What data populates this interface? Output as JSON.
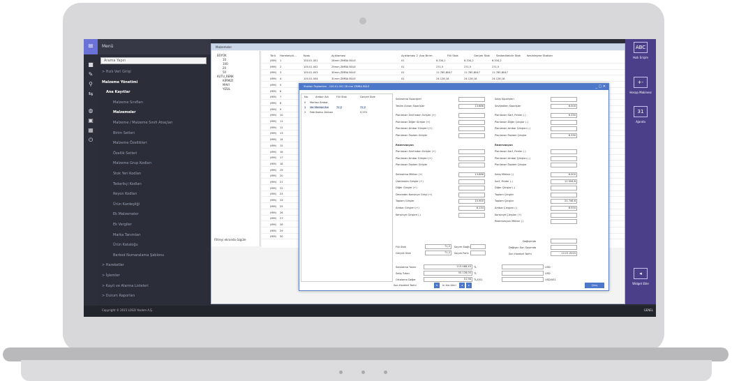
{
  "sidebar": {
    "title": "Menü",
    "search_placeholder": "Arama Yapın",
    "items": [
      {
        "label": "> Hızlı Veri Girişi",
        "bold": false
      },
      {
        "label": "Malzeme Yönetimi",
        "bold": true
      },
      {
        "label": "Ana Kayıtlar",
        "bold": true
      },
      {
        "label": "Malzeme Sınıfları",
        "bold": false
      },
      {
        "label": "Malzemeler",
        "bold": true
      },
      {
        "label": "Malzeme / Malzeme Sınıfı Atıaçları",
        "bold": false
      },
      {
        "label": "Birim Setleri",
        "bold": false
      },
      {
        "label": "Malzeme Özellikleri",
        "bold": false
      },
      {
        "label": "Özellik Setleri",
        "bold": false
      },
      {
        "label": "Malzeme Grup Kodları",
        "bold": false
      },
      {
        "label": "Stok Yeri Kodları",
        "bold": false
      },
      {
        "label": "Tedarikçi Kodları",
        "bold": false
      },
      {
        "label": "Reyon Kodları",
        "bold": false
      },
      {
        "label": "Ürün Kardeşliği",
        "bold": false
      },
      {
        "label": "Ek Malzemeler",
        "bold": false
      },
      {
        "label": "Ek Vergiler",
        "bold": false
      },
      {
        "label": "Marka Tanımları",
        "bold": false
      },
      {
        "label": "Ürün Kataloğu",
        "bold": false
      },
      {
        "label": "Barkod Numaralama Şablonu",
        "bold": false
      },
      {
        "label": "> Hareketler",
        "bold": false
      },
      {
        "label": "> İşlemler",
        "bold": false
      },
      {
        "label": "> Kayıt ve Alarma Listeleri",
        "bold": false
      },
      {
        "label": "> Durum Raporları",
        "bold": false
      }
    ]
  },
  "footer": {
    "copyright": "Copyright © 2015 LOGO Yazılım A.Ş.",
    "right": "GENEL"
  },
  "main_window": {
    "title": "Malzemeler",
    "tree": [
      "BÜYÜK",
      "10",
      "100",
      "20",
      "50",
      "KUTU_RENK",
      "KIRMIZI",
      "MAVI",
      "YESIL"
    ],
    "tree_footer": "Filtreyi ekranda özgüle",
    "columns": [
      "Türü",
      "Hareketçili...",
      "Kodu",
      "Açıklaması",
      "Açıklaması 2",
      "Ana Birim",
      "Fiili Stok",
      "Gerçek Stok",
      "Sevkedilebilir Stok",
      "Kesinleşme Stokları"
    ],
    "rows": [
      [
        "(MM)",
        "1",
        "100.01.001",
        "28mm ZIMBA BÜLE",
        "01",
        "6.334,1",
        "6.334,2",
        "6.334,2"
      ],
      [
        "(MM)",
        "2",
        "100.01.002",
        "29mm ZIMBA BÜLE",
        "01",
        "271,5",
        "271,5",
        "271,5"
      ],
      [
        "(MM)",
        "3",
        "100.01.003",
        "30mm ZIMBA BÜLE",
        "01",
        "11.780,8047",
        "11.780,8047",
        "11.780,8047"
      ],
      [
        "(MM)",
        "4",
        "100.01.004",
        "31mm ZIMBA BÜLE",
        "01",
        "24.128,18",
        "24.128,18",
        "24.128,18"
      ],
      [
        "(MM)",
        "5",
        "",
        "",
        "",
        "",
        "",
        ""
      ],
      [
        "(MM)",
        "6",
        "",
        "",
        "",
        "",
        "",
        ""
      ],
      [
        "(MM)",
        "7",
        "",
        "",
        "",
        "",
        "",
        ""
      ],
      [
        "(MM)",
        "8",
        "",
        "",
        "",
        "",
        "",
        ""
      ],
      [
        "(MM)",
        "9",
        "",
        "",
        "",
        "",
        "",
        ""
      ],
      [
        "(MM)",
        "10",
        "",
        "",
        "",
        "",
        "",
        ""
      ],
      [
        "(MM)",
        "11",
        "",
        "",
        "",
        "",
        "",
        ""
      ],
      [
        "(MM)",
        "12",
        "",
        "",
        "",
        "",
        "",
        ""
      ],
      [
        "(MM)",
        "13",
        "",
        "",
        "",
        "",
        "",
        ""
      ],
      [
        "(MM)",
        "14",
        "",
        "",
        "",
        "",
        "",
        ""
      ],
      [
        "(MM)",
        "15",
        "",
        "",
        "",
        "",
        "",
        ""
      ],
      [
        "(MM)",
        "16",
        "",
        "",
        "",
        "",
        "",
        ""
      ],
      [
        "(MM)",
        "17",
        "",
        "",
        "",
        "",
        "",
        ""
      ],
      [
        "(MM)",
        "18",
        "",
        "",
        "",
        "",
        "",
        ""
      ],
      [
        "(MM)",
        "19",
        "",
        "",
        "",
        "",
        "",
        ""
      ],
      [
        "(MM)",
        "20",
        "",
        "",
        "",
        "",
        "",
        ""
      ],
      [
        "(MM)",
        "21",
        "",
        "",
        "",
        "",
        "",
        ""
      ],
      [
        "(MM)",
        "22",
        "",
        "",
        "",
        "",
        "",
        ""
      ],
      [
        "(MM)",
        "23",
        "",
        "",
        "",
        "",
        "",
        ""
      ],
      [
        "(MM)",
        "24",
        "",
        "",
        "",
        "",
        "",
        ""
      ],
      [
        "(MM)",
        "25",
        "",
        "",
        "",
        "",
        "",
        ""
      ],
      [
        "(MM)",
        "26",
        "",
        "",
        "",
        "",
        "",
        ""
      ],
      [
        "(MM)",
        "27",
        "",
        "",
        "",
        "",
        "",
        ""
      ],
      [
        "(MM)",
        "28",
        "",
        "",
        "",
        "",
        "",
        ""
      ],
      [
        "(MM)",
        "29",
        "",
        "",
        "",
        "",
        "",
        ""
      ],
      [
        "(MM)",
        "30",
        "",
        "",
        "",
        "",
        "",
        ""
      ]
    ]
  },
  "dialog": {
    "title": "Stokları Toplamları - 100.01.001 28 mm ZIMBA BÜLE",
    "list_headers": [
      "No.",
      "Ambar Adı",
      "Fiili Stok",
      "Gerçek Stok"
    ],
    "list_rows": [
      [
        "0",
        "Merkez Ambar",
        "",
        ""
      ],
      [
        "1",
        "Ver Merkez Am",
        "71,2",
        "71,2"
      ],
      [
        "2",
        "Fabrikamız Ambarı",
        "",
        "0,251"
      ]
    ],
    "left_fields": [
      {
        "label": "Satınalma Siparişleri",
        "value": "",
        "bold": false
      },
      {
        "label": "Teslim Alınan Siparişler",
        "value": "13.686",
        "bold": false
      },
      {
        "label": "Planlanan Sınıfından Girişler (+)",
        "value": "",
        "bold": false
      },
      {
        "label": "Planlanan Diğer Girişler (+)",
        "value": "",
        "bold": false
      },
      {
        "label": "Planlanan Ambar Girişleri (+)",
        "value": "",
        "bold": false
      },
      {
        "label": "Planlanan Toplam Girişler",
        "value": "",
        "bold": false
      },
      {
        "label": "Rezervasyon",
        "value": "",
        "bold": true
      },
      {
        "label": "Planlanan Sınıfından Girişler (+)",
        "value": "",
        "bold": false
      },
      {
        "label": "Planlanan Ambar Girişleri (+)",
        "value": "",
        "bold": false
      },
      {
        "label": "Planlanan Toplam Girişler",
        "value": "",
        "bold": false
      },
      {
        "label": "Satınalma Miktarı (+)",
        "value": "13.686",
        "bold": false
      },
      {
        "label": "Üretimden Girişler (+)",
        "value": "",
        "bold": false
      },
      {
        "label": "Diğer Girişler (+)",
        "value": "",
        "bold": false
      },
      {
        "label": "Devreden Konsinye Girişi (+)",
        "value": "",
        "bold": false
      },
      {
        "label": "Toplam Girişler",
        "value": "15.900",
        "bold": false
      },
      {
        "label": "Ambar Girişleri (+)",
        "value": "8.134",
        "bold": false
      },
      {
        "label": "Konsinye Girişleri (-)",
        "value": "",
        "bold": false
      }
    ],
    "right_fields": [
      {
        "label": "Satış Siparişleri",
        "value": "",
        "bold": false
      },
      {
        "label": "Sevkedilen Siparişler",
        "value": "6.000",
        "bold": false
      },
      {
        "label": "Planlanan Sarf, Fireler (-)",
        "value": "6.330",
        "bold": false
      },
      {
        "label": "Planlanan Diğer Çıkışlar (-)",
        "value": "",
        "bold": false
      },
      {
        "label": "Planlanan Ambar Çıkışları (-)",
        "value": "",
        "bold": false
      },
      {
        "label": "Planlanan Toplam Çıkışlar",
        "value": "6.330",
        "bold": false
      },
      {
        "label": "Rezervasyon",
        "value": "",
        "bold": true
      },
      {
        "label": "Planlanan Sarf, Fireler (-)",
        "value": "",
        "bold": false
      },
      {
        "label": "Planlanan Ambar Çıkışları (-)",
        "value": "",
        "bold": false
      },
      {
        "label": "Planlanan Toplam Çıkışlar",
        "value": "",
        "bold": false
      },
      {
        "label": "Satış Miktarı (-)",
        "value": "6.000",
        "bold": false
      },
      {
        "label": "Sarf, Fireler (-)",
        "value": "11.506,6",
        "bold": false
      },
      {
        "label": "Diğer Çıkışlar (-)",
        "value": "",
        "bold": false
      },
      {
        "label": "Toplam Çıkışlar",
        "value": "",
        "bold": false
      },
      {
        "label": "Toplam Çıkışlar",
        "value": "21.746,6",
        "bold": false
      },
      {
        "label": "Ambar Çıkışları (-)",
        "value": "8.550",
        "bold": false
      },
      {
        "label": "Konsinye Çıkışları (+)",
        "value": "",
        "bold": false
      },
      {
        "label": "Rezervasyon Miktarı (-)",
        "value": "",
        "bold": false
      }
    ],
    "bottom": {
      "fiili_stok_label": "Fiili Stok",
      "fiili_stok": "71,2",
      "sayim_label": "Sayım Stoğu",
      "gercek_stok_label": "Gerçek Stok",
      "gercek_stok": "71,2",
      "sayim_farki_label": "Sayım Farkı",
      "degisimde_label": "Değişimde",
      "son_sayim_label": "Değişen Son Sayımda",
      "son_hareket_label": "Son Hareket Tarihi",
      "son_hareket": "12.01.2015",
      "satin_alma_label": "Satınalma Tutarı",
      "satin_alma": "115.468,45",
      "satin_alma_unit": "TL",
      "satin_alma_cur": "USD",
      "satis_label": "Satış Tutarı",
      "satis": "55.128,00",
      "satis_unit": "TL",
      "satis_cur": "USD",
      "ortalama_label": "Ortalama Değer",
      "ortalama": "51,98",
      "ortalama_unit": "TL/001",
      "ortalama_cur": "USD/001",
      "son_hareket_btn": "Son Hareket Tarihi",
      "in_the_label": "İn the Ahiri",
      "close_btn": "Çıkış"
    }
  },
  "right_panel": {
    "items": [
      {
        "icon": "ABC",
        "label": "Hızlı Erişim"
      },
      {
        "icon": "+-",
        "label": "Hesap Makinesi"
      },
      {
        "icon": "31",
        "label": "Ajanda"
      },
      {
        "icon": "◂",
        "label": "Widget Ekle"
      }
    ]
  }
}
